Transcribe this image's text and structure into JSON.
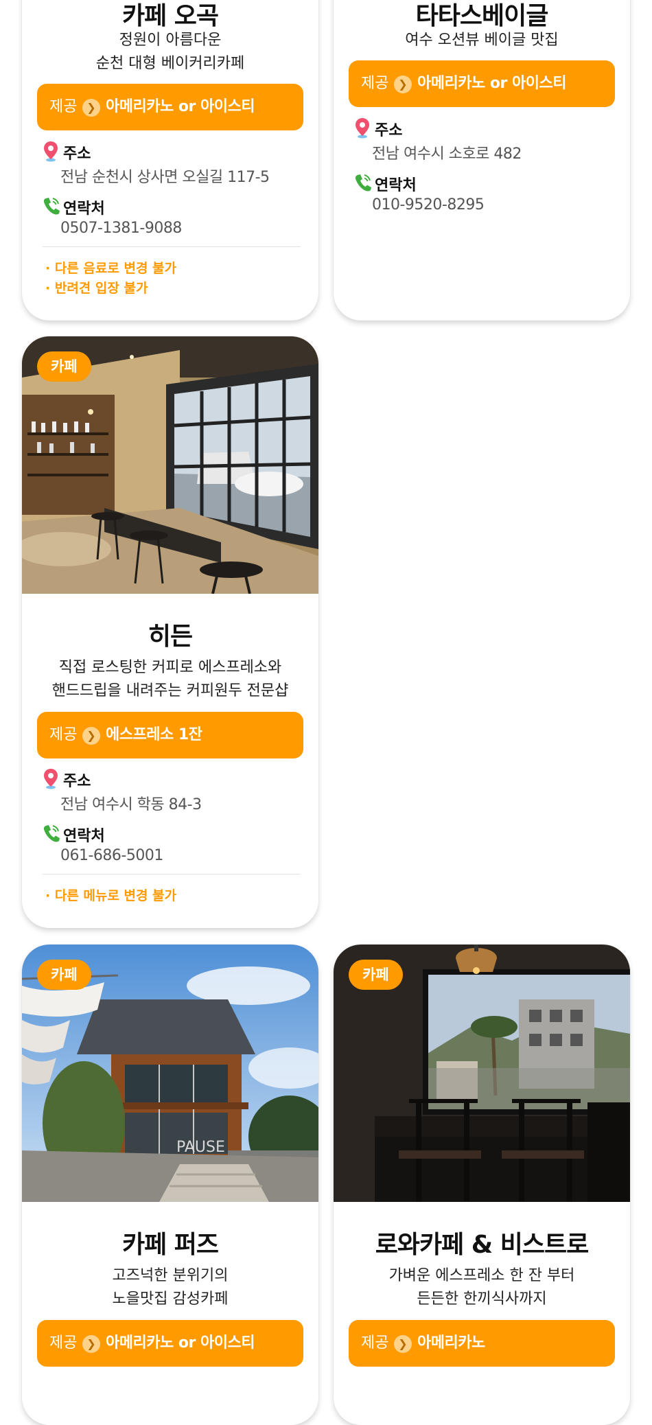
{
  "labels": {
    "offer": "제공",
    "address": "주소",
    "contact": "연락처"
  },
  "colors": {
    "accent": "#ff9a00",
    "note": "#ff9a00"
  },
  "cards": [
    {
      "title": "카페 오곡",
      "desc_lines": [
        "정원이 아름다운",
        "순천 대형 베이커리카페"
      ],
      "offer": "아메리카노 or 아이스티",
      "address": "전남 순천시 상사면 오실길 117-5",
      "phone": "0507-1381-9088",
      "notes": [
        "· 다른 음료로 변경 불가",
        "· 반려견 입장 불가"
      ]
    },
    {
      "title": "타타스베이글",
      "desc_lines": [
        "여수 오션뷰 베이글 맛집"
      ],
      "offer": "아메리카노 or 아이스티",
      "address": "전남 여수시 소호로 482",
      "phone": "010-9520-8295",
      "notes": []
    },
    {
      "tag": "카페",
      "image_icon": "cafe-interior-image",
      "title": "히든",
      "desc_lines": [
        "직접 로스팅한 커피로 에스프레소와",
        "핸드드립을 내려주는 커피원두 전문샵"
      ],
      "offer": "에스프레소 1잔",
      "address": "전남 여수시 학동 84-3",
      "phone": "061-686-5001",
      "notes": [
        "· 다른 메뉴로 변경 불가"
      ]
    },
    {
      "tag": "카페",
      "image_icon": "cafe-building-image",
      "image_sign": "PAUSE",
      "title": "카페 퍼즈",
      "desc_lines": [
        "고즈넉한 분위기의",
        "노을맛집 감성카페"
      ],
      "offer": "아메리카노 or 아이스티"
    },
    {
      "tag": "카페",
      "image_icon": "bistro-window-image",
      "title": "로와카페 & 비스트로",
      "desc_lines": [
        "가벼운 에스프레소 한 잔 부터",
        "든든한 한끼식사까지"
      ],
      "offer": "아메리카노"
    }
  ]
}
